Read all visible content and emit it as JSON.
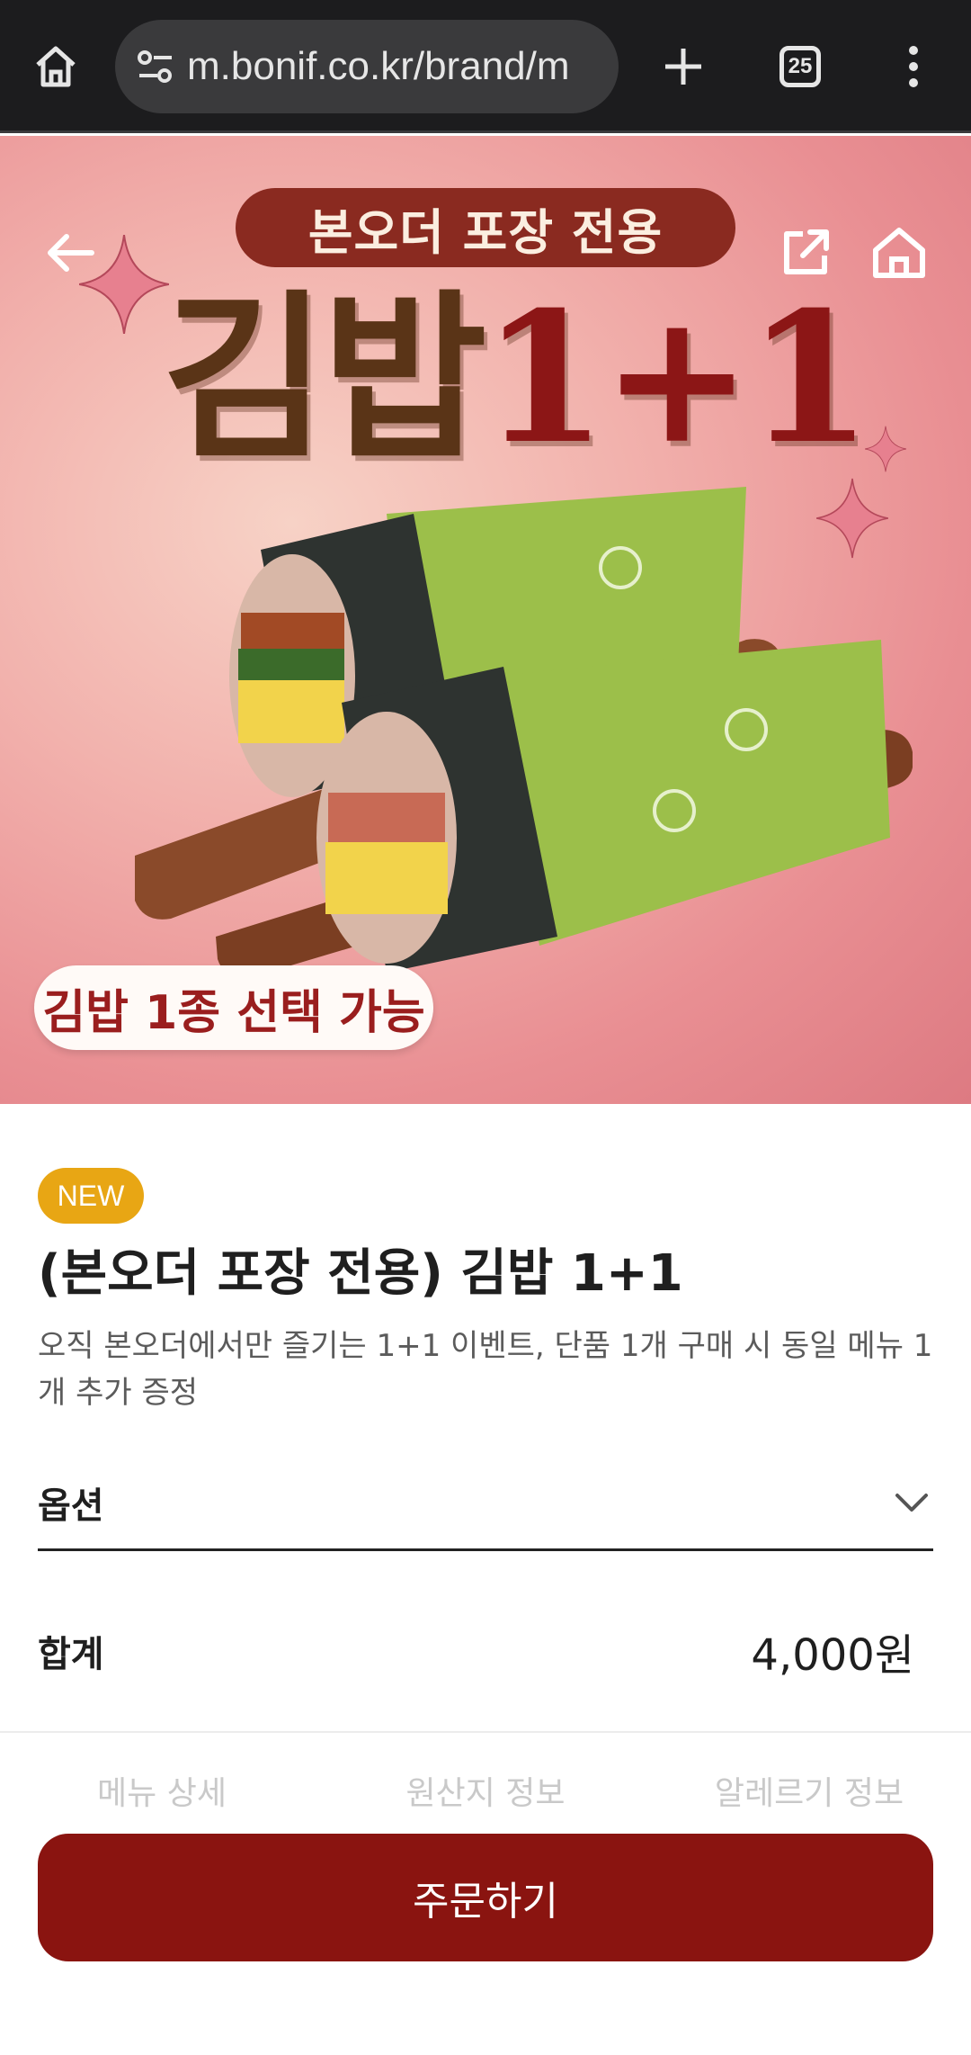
{
  "browser": {
    "url": "m.bonif.co.kr/brand/m",
    "tab_count": "25"
  },
  "hero": {
    "banner_pill": "본오더 포장 전용",
    "title_main": "김밥",
    "title_deal": "1+1",
    "select_badge": "김밥 1종 선택 가능"
  },
  "product": {
    "badge": "NEW",
    "title": "(본오더 포장 전용) 김밥 1+1",
    "description": "오직 본오더에서만 즐기는 1+1 이벤트, 단품 1개 구매 시 동일 메뉴 1개 추가 증정"
  },
  "option": {
    "label": "옵션"
  },
  "total": {
    "label": "합계",
    "price": "4,000원"
  },
  "tabs": [
    {
      "label": "메뉴 상세"
    },
    {
      "label": "원산지 정보"
    },
    {
      "label": "알레르기 정보"
    }
  ],
  "order_button": {
    "label": "주문하기"
  },
  "colors": {
    "brand": "#8a1410",
    "new_badge": "#e8a614",
    "wrap_green": "#9cbf4a"
  }
}
